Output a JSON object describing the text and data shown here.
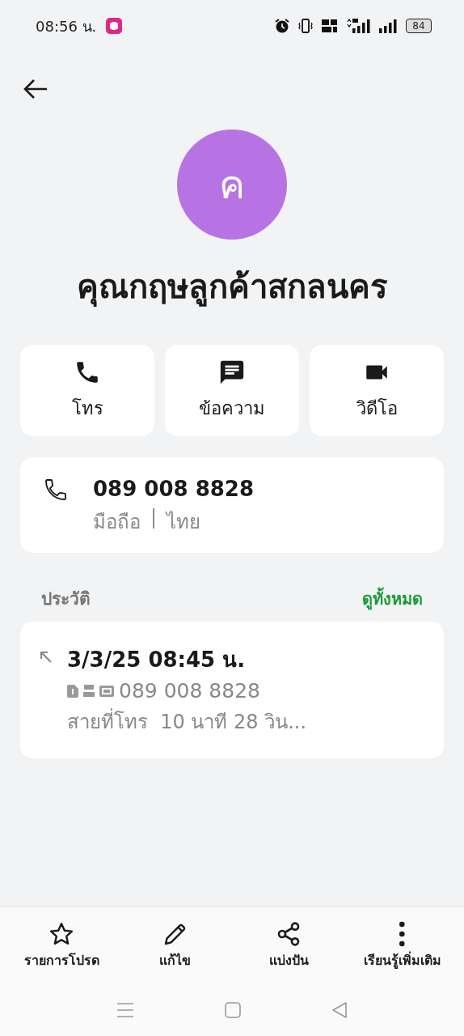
{
  "status_bar": {
    "time": "08:56 น.",
    "battery": "84"
  },
  "contact": {
    "initial": "ค",
    "name": "คุณกฤษลูกค้าสกลนคร"
  },
  "actions": [
    {
      "kind": "call",
      "label": "โทร"
    },
    {
      "kind": "message",
      "label": "ข้อความ"
    },
    {
      "kind": "video",
      "label": "วิดีโอ"
    }
  ],
  "phone": {
    "number": "089 008 8828",
    "type": "มือถือ",
    "separator": "|",
    "region": "ไทย"
  },
  "history": {
    "title": "ประวัติ",
    "view_all": "ดูทั้งหมด",
    "entries": [
      {
        "kind": "outgoing",
        "datetime": "3/3/25 08:45 น.",
        "number": "089 008 8828",
        "duration": "สายที่โทร  10 นาที 28 วิน..."
      }
    ]
  },
  "bottom_bar": [
    {
      "kind": "star",
      "label": "รายการโปรด"
    },
    {
      "kind": "edit",
      "label": "แก้ไข"
    },
    {
      "kind": "share",
      "label": "แบ่งปัน"
    },
    {
      "kind": "more",
      "label": "เรียนรู้เพิ่มเติม"
    }
  ]
}
